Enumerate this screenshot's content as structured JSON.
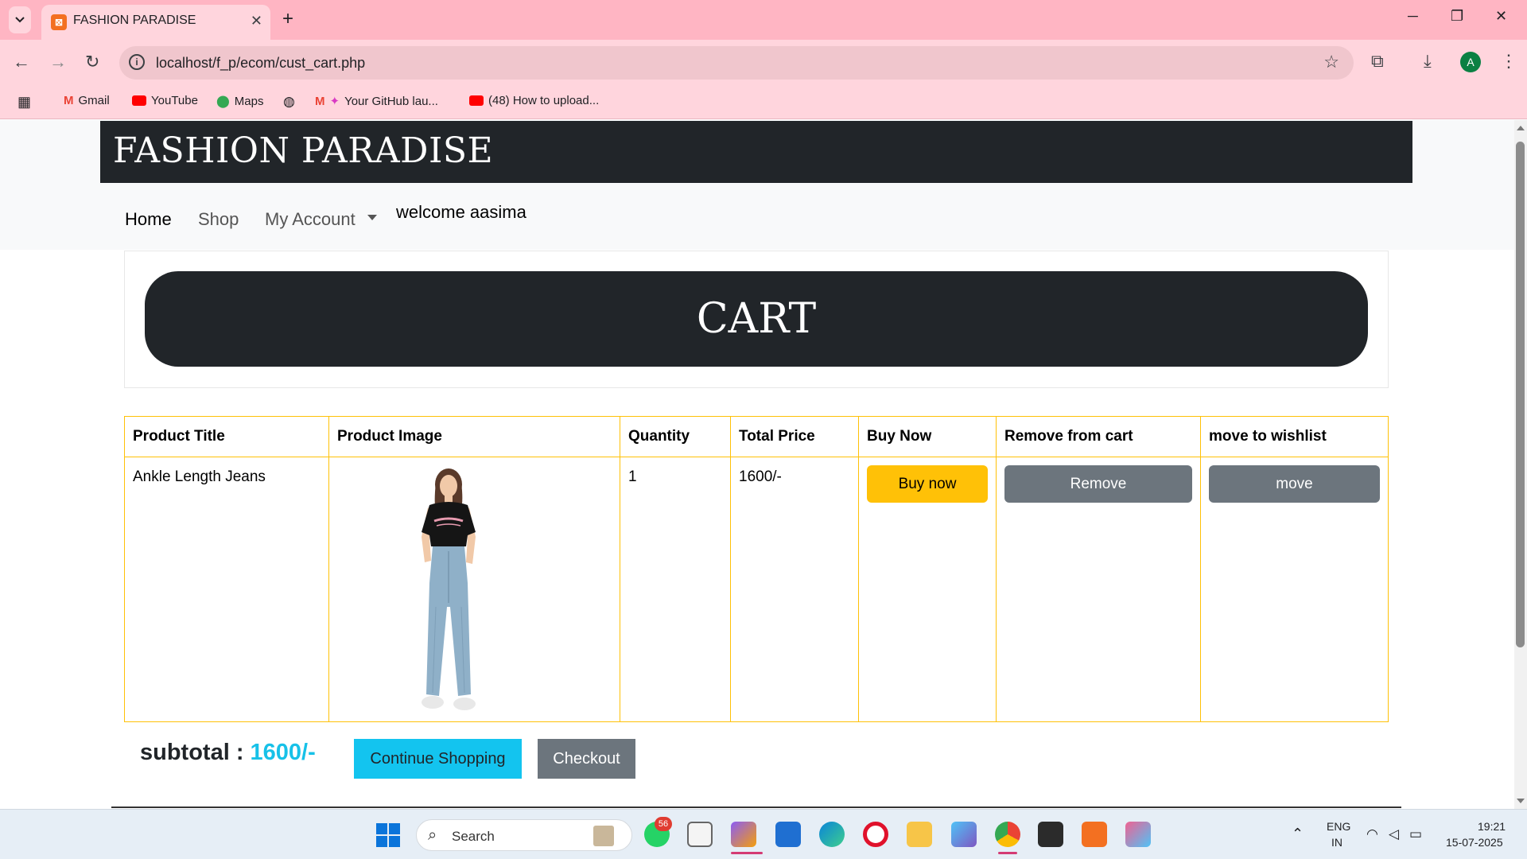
{
  "browser": {
    "tab_title": "FASHION PARADISE",
    "url": "localhost/f_p/ecom/cust_cart.php",
    "profile_initial": "A",
    "bookmarks": [
      "Gmail",
      "YouTube",
      "Maps",
      "Your GitHub lau...",
      "(48) How to upload..."
    ]
  },
  "site": {
    "brand": "FASHION PARADISE",
    "nav": {
      "home": "Home",
      "shop": "Shop",
      "account": "My Account",
      "welcome": "welcome aasima"
    }
  },
  "cart": {
    "heading": "CART",
    "columns": [
      "Product Title",
      "Product Image",
      "Quantity",
      "Total Price",
      "Buy Now",
      "Remove from cart",
      "move to wishlist"
    ],
    "rows": [
      {
        "title": "Ankle Length Jeans",
        "quantity": "1",
        "total_price": "1600/-",
        "buy_label": "Buy now",
        "remove_label": "Remove",
        "move_label": "move"
      }
    ],
    "subtotal_label": "subtotal : ",
    "subtotal_value": "1600/-",
    "continue_label": "Continue Shopping",
    "checkout_label": "Checkout"
  },
  "taskbar": {
    "search_label": "Search",
    "whatsapp_badge": "56",
    "language": "ENG",
    "region": "IN",
    "time": "19:21",
    "date": "15-07-2025"
  },
  "colors": {
    "brand_bg": "#212529",
    "table_border": "#ffc107",
    "buy_button": "#ffc107",
    "secondary_button": "#6c757d",
    "subtotal_accent": "#17c1e8",
    "continue_button": "#13c4ef"
  }
}
